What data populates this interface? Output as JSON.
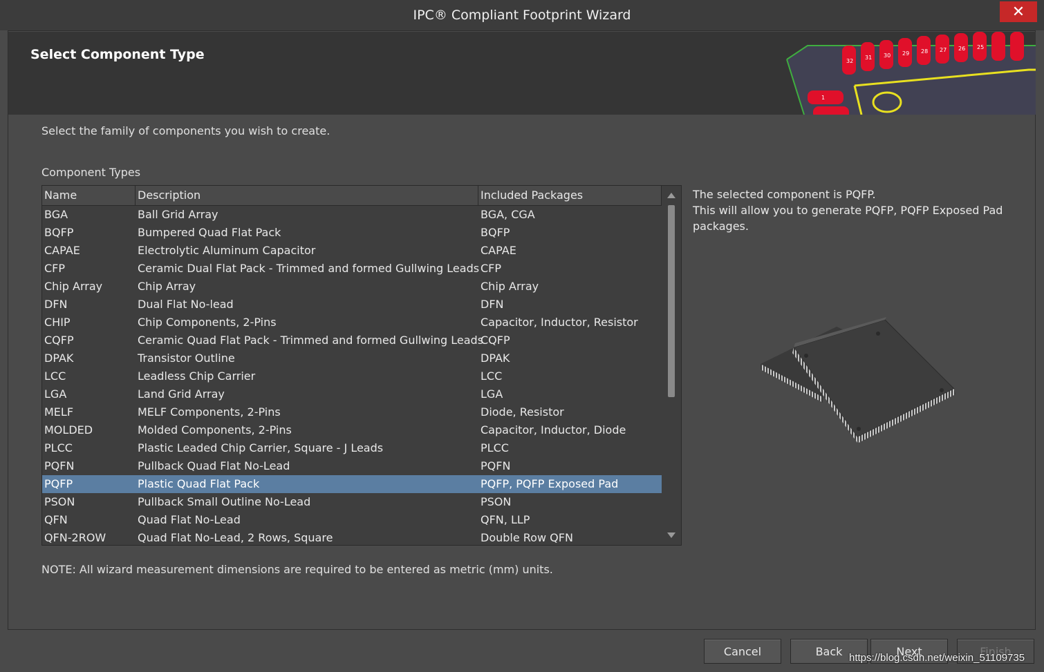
{
  "window": {
    "title": "IPC® Compliant Footprint Wizard",
    "close_label": "✕"
  },
  "header": {
    "title": "Select Component Type",
    "pad_labels": [
      "32",
      "31",
      "30",
      "29",
      "28",
      "27",
      "26",
      "25",
      "1"
    ]
  },
  "instruction": "Select the family of components you wish to create.",
  "component_types": {
    "label": "Component Types",
    "columns": [
      "Name",
      "Description",
      "Included Packages"
    ],
    "rows": [
      {
        "name": "BGA",
        "description": "Ball Grid Array",
        "packages": "BGA, CGA"
      },
      {
        "name": "BQFP",
        "description": "Bumpered Quad Flat Pack",
        "packages": "BQFP"
      },
      {
        "name": "CAPAE",
        "description": "Electrolytic Aluminum Capacitor",
        "packages": "CAPAE"
      },
      {
        "name": "CFP",
        "description": "Ceramic Dual Flat Pack - Trimmed and formed Gullwing Leads",
        "packages": "CFP"
      },
      {
        "name": "Chip Array",
        "description": "Chip Array",
        "packages": "Chip Array"
      },
      {
        "name": "DFN",
        "description": "Dual Flat No-lead",
        "packages": "DFN"
      },
      {
        "name": "CHIP",
        "description": "Chip Components, 2-Pins",
        "packages": "Capacitor, Inductor, Resistor"
      },
      {
        "name": "CQFP",
        "description": "Ceramic Quad Flat Pack - Trimmed and formed Gullwing Leads",
        "packages": "CQFP"
      },
      {
        "name": "DPAK",
        "description": "Transistor Outline",
        "packages": "DPAK"
      },
      {
        "name": "LCC",
        "description": "Leadless Chip Carrier",
        "packages": "LCC"
      },
      {
        "name": "LGA",
        "description": "Land Grid Array",
        "packages": "LGA"
      },
      {
        "name": "MELF",
        "description": "MELF Components, 2-Pins",
        "packages": "Diode, Resistor"
      },
      {
        "name": "MOLDED",
        "description": "Molded Components, 2-Pins",
        "packages": "Capacitor, Inductor, Diode"
      },
      {
        "name": "PLCC",
        "description": "Plastic Leaded Chip Carrier, Square - J Leads",
        "packages": "PLCC"
      },
      {
        "name": "PQFN",
        "description": "Pullback Quad Flat No-Lead",
        "packages": "PQFN"
      },
      {
        "name": "PQFP",
        "description": "Plastic Quad Flat Pack",
        "packages": "PQFP, PQFP Exposed Pad",
        "selected": true
      },
      {
        "name": "PSON",
        "description": "Pullback Small Outline No-Lead",
        "packages": "PSON"
      },
      {
        "name": "QFN",
        "description": "Quad Flat No-Lead",
        "packages": "QFN, LLP"
      },
      {
        "name": "QFN-2ROW",
        "description": "Quad Flat No-Lead, 2 Rows, Square",
        "packages": "Double Row QFN"
      }
    ]
  },
  "selection_info": {
    "line1": "The selected component is PQFP.",
    "line2": "This will allow you to generate PQFP, PQFP Exposed Pad packages."
  },
  "note": "NOTE: All wizard measurement dimensions are required to be entered as metric (mm) units.",
  "buttons": {
    "cancel": "Cancel",
    "back": "Back",
    "next": "Next",
    "finish": "Finish"
  },
  "watermark": "https://blog.csdn.net/weixin_51109735",
  "colors": {
    "selection": "#5b7ea2",
    "pad_red": "#e0102a",
    "silkscreen_yellow": "#e8e020",
    "board_outline_green": "#3fae3f"
  }
}
